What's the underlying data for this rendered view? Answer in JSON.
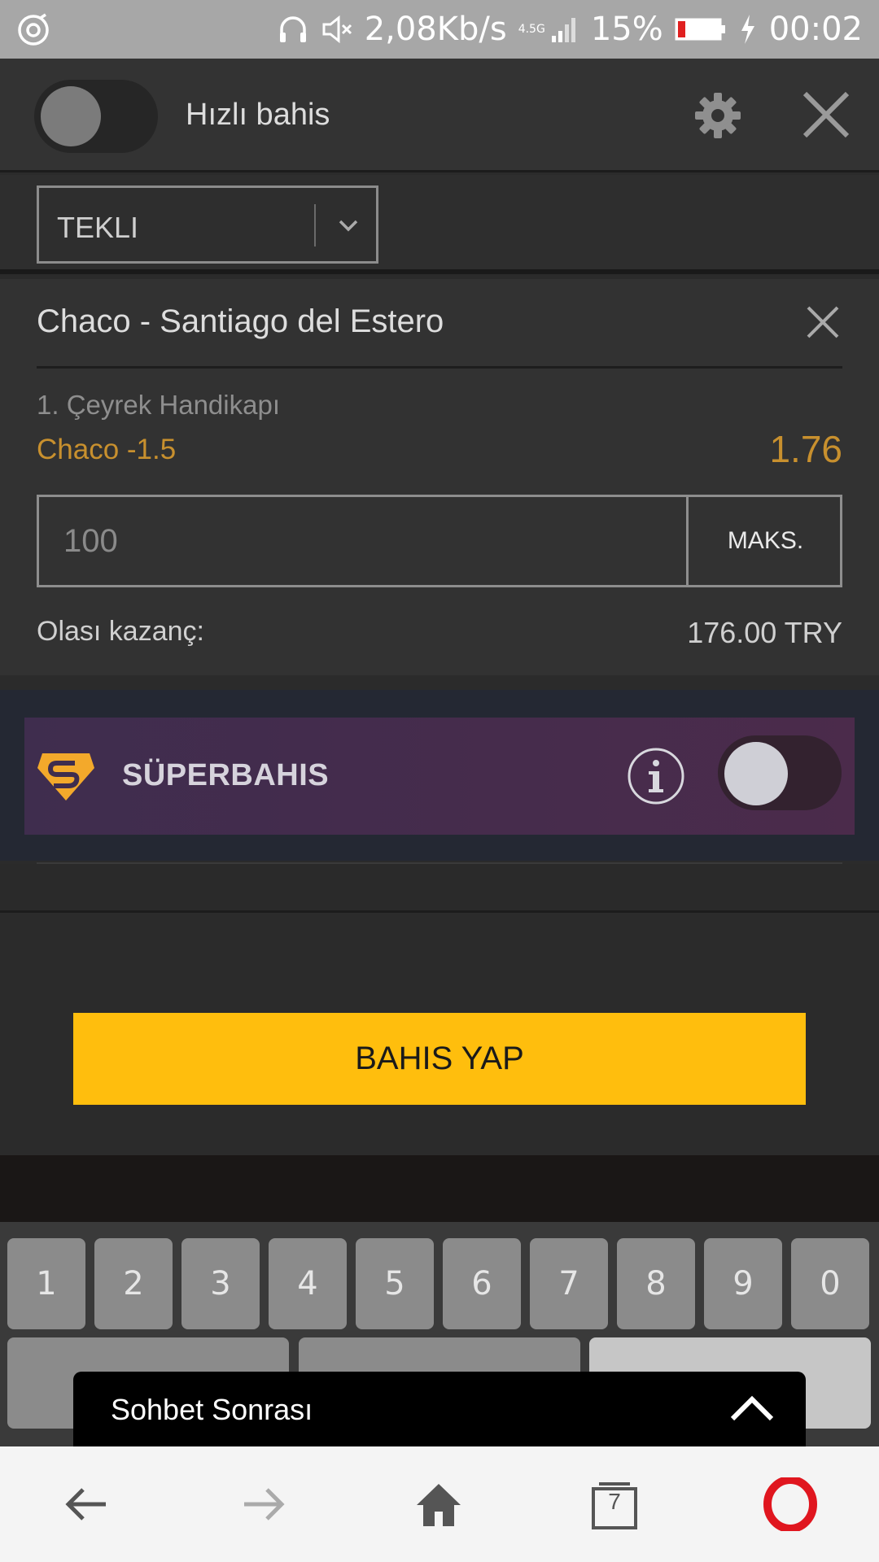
{
  "status_bar": {
    "speed": "2,08Kb/s",
    "network": "4.5G",
    "battery": "15%",
    "time": "00:02"
  },
  "header": {
    "quick_bet_label": "Hızlı bahis",
    "quick_bet_on": false
  },
  "bet_type": {
    "selected": "TEKLI"
  },
  "bet": {
    "match": "Chaco - Santiago del Estero",
    "market": "1. Çeyrek Handikapı",
    "selection": "Chaco -1.5",
    "odds": "1.76",
    "stake_placeholder": "100",
    "max_label": "MAKS.",
    "potential_win_label": "Olası kazanç:",
    "potential_win_value": "176.00 TRY"
  },
  "super_bet": {
    "label": "SÜPERBAHIS",
    "enabled": false
  },
  "place_bet_label": "BAHIS YAP",
  "keyboard": {
    "digits": [
      "1",
      "2",
      "3",
      "4",
      "5",
      "6",
      "7",
      "8",
      "9",
      "0"
    ]
  },
  "chat": {
    "label": "Sohbet Sonrası"
  },
  "browser_nav": {
    "tabs_count": "7"
  },
  "colors": {
    "accent_yellow": "#ffbe0d",
    "odds_orange": "#c8902e",
    "opera_red": "#e0161f"
  }
}
